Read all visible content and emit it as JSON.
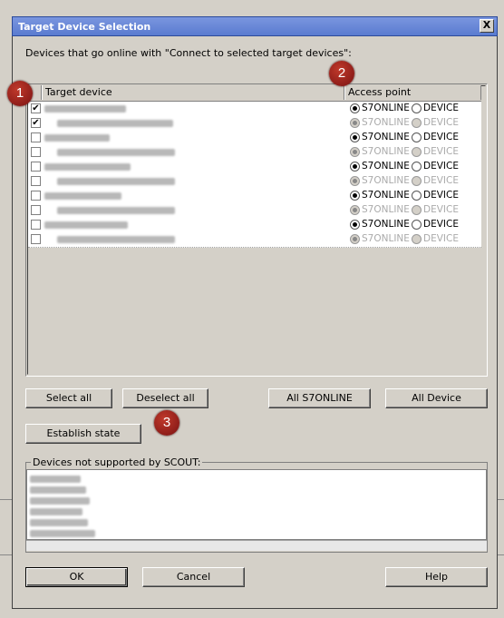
{
  "window": {
    "title": "Target Device Selection",
    "close_glyph": "X"
  },
  "intro_label": "Devices that go online with \"Connect to selected target devices\":",
  "table": {
    "headers": {
      "target_device": "Target device",
      "access_point": "Access point"
    },
    "rows": [
      {
        "checked": true,
        "access_point": "S7ONLINE",
        "enabled": true
      },
      {
        "checked": true,
        "access_point": "S7ONLINE",
        "enabled": false
      },
      {
        "checked": false,
        "access_point": "S7ONLINE",
        "enabled": true
      },
      {
        "checked": false,
        "access_point": "S7ONLINE",
        "enabled": false
      },
      {
        "checked": false,
        "access_point": "S7ONLINE",
        "enabled": true
      },
      {
        "checked": false,
        "access_point": "S7ONLINE",
        "enabled": false
      },
      {
        "checked": false,
        "access_point": "S7ONLINE",
        "enabled": true
      },
      {
        "checked": false,
        "access_point": "S7ONLINE",
        "enabled": false
      },
      {
        "checked": false,
        "access_point": "S7ONLINE",
        "enabled": true
      },
      {
        "checked": false,
        "access_point": "S7ONLINE",
        "enabled": false
      }
    ],
    "option_s7online": "S7ONLINE",
    "option_device": "DEVICE",
    "check_glyph": "✔"
  },
  "buttons": {
    "select_all": "Select all",
    "deselect_all": "Deselect all",
    "all_s7online": "All S7ONLINE",
    "all_device": "All Device",
    "establish_state": "Establish state",
    "ok": "OK",
    "cancel": "Cancel",
    "help": "Help"
  },
  "unsupported": {
    "label": "Devices not supported by SCOUT:"
  },
  "badges": {
    "b1": "1",
    "b2": "2",
    "b3": "3"
  },
  "colors": {
    "badge": "#9b1c1c",
    "title_bar": "#6a88d8"
  }
}
